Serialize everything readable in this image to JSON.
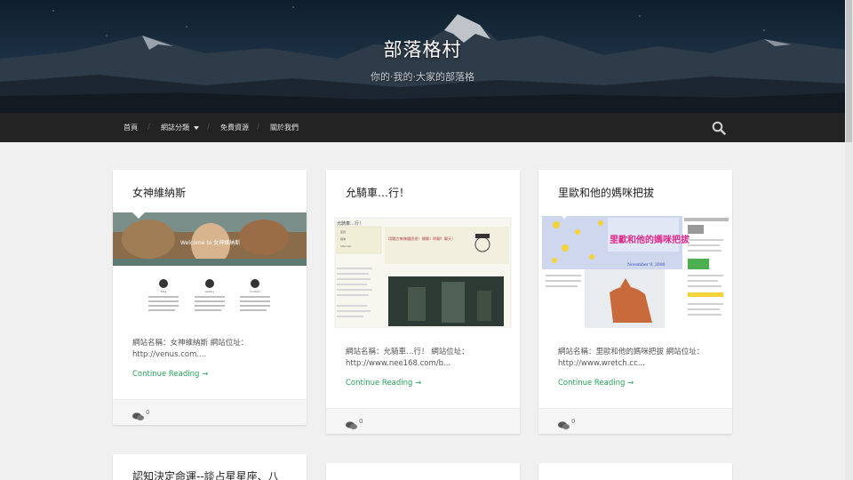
{
  "site": {
    "title": "部落格村",
    "description": "你的·我的·大家的部落格"
  },
  "nav": {
    "items": [
      {
        "label": "首頁"
      },
      {
        "label": "網誌分類",
        "has_dropdown": true
      },
      {
        "label": "免費資源"
      },
      {
        "label": "關於我們"
      }
    ],
    "separator": "/"
  },
  "posts": [
    {
      "title": "女神維納斯",
      "excerpt": "網站名稱：女神維納斯 網站位址：http://venus.com....",
      "continue_label": "Continue Reading →",
      "comment_count": "0",
      "thumbnail": {
        "banner_text": "Welcome to 女神維納斯",
        "icon_captions": [
          "Blog",
          "Gallery",
          "Contact"
        ]
      }
    },
    {
      "title": "允騎車…行！",
      "excerpt": "網站名稱：允騎車…行！ 網站位址：http://www.nee168.com/b...",
      "continue_label": "Continue Reading →",
      "comment_count": "0",
      "thumbnail": {
        "site_name": "允騎車…行！",
        "headline": "用戰力來煉鐵訊息！開聊！明聊！聊天！",
        "menu": [
          "首頁",
          "相簿",
          "Sitemap"
        ]
      }
    },
    {
      "title": "里歐和他的媽咪把拔",
      "excerpt": "網站名稱：里歐和他的媽咪把拔 網站位址：http://www.wretch.cc...",
      "continue_label": "Continue Reading →",
      "comment_count": "0",
      "thumbnail": {
        "banner_title": "里歐和他的媽咪把拔",
        "date": "November 9, 2008"
      }
    },
    {
      "title": "認知決定命運--談占星星座、八"
    }
  ],
  "colors": {
    "accent_green": "#27a25a",
    "nav_background": "#232323",
    "page_background": "#f0f0f0"
  },
  "icons": {
    "search": "magnifier-icon",
    "comments": "speech-bubbles-icon",
    "dropdown": "caret-down-icon"
  }
}
